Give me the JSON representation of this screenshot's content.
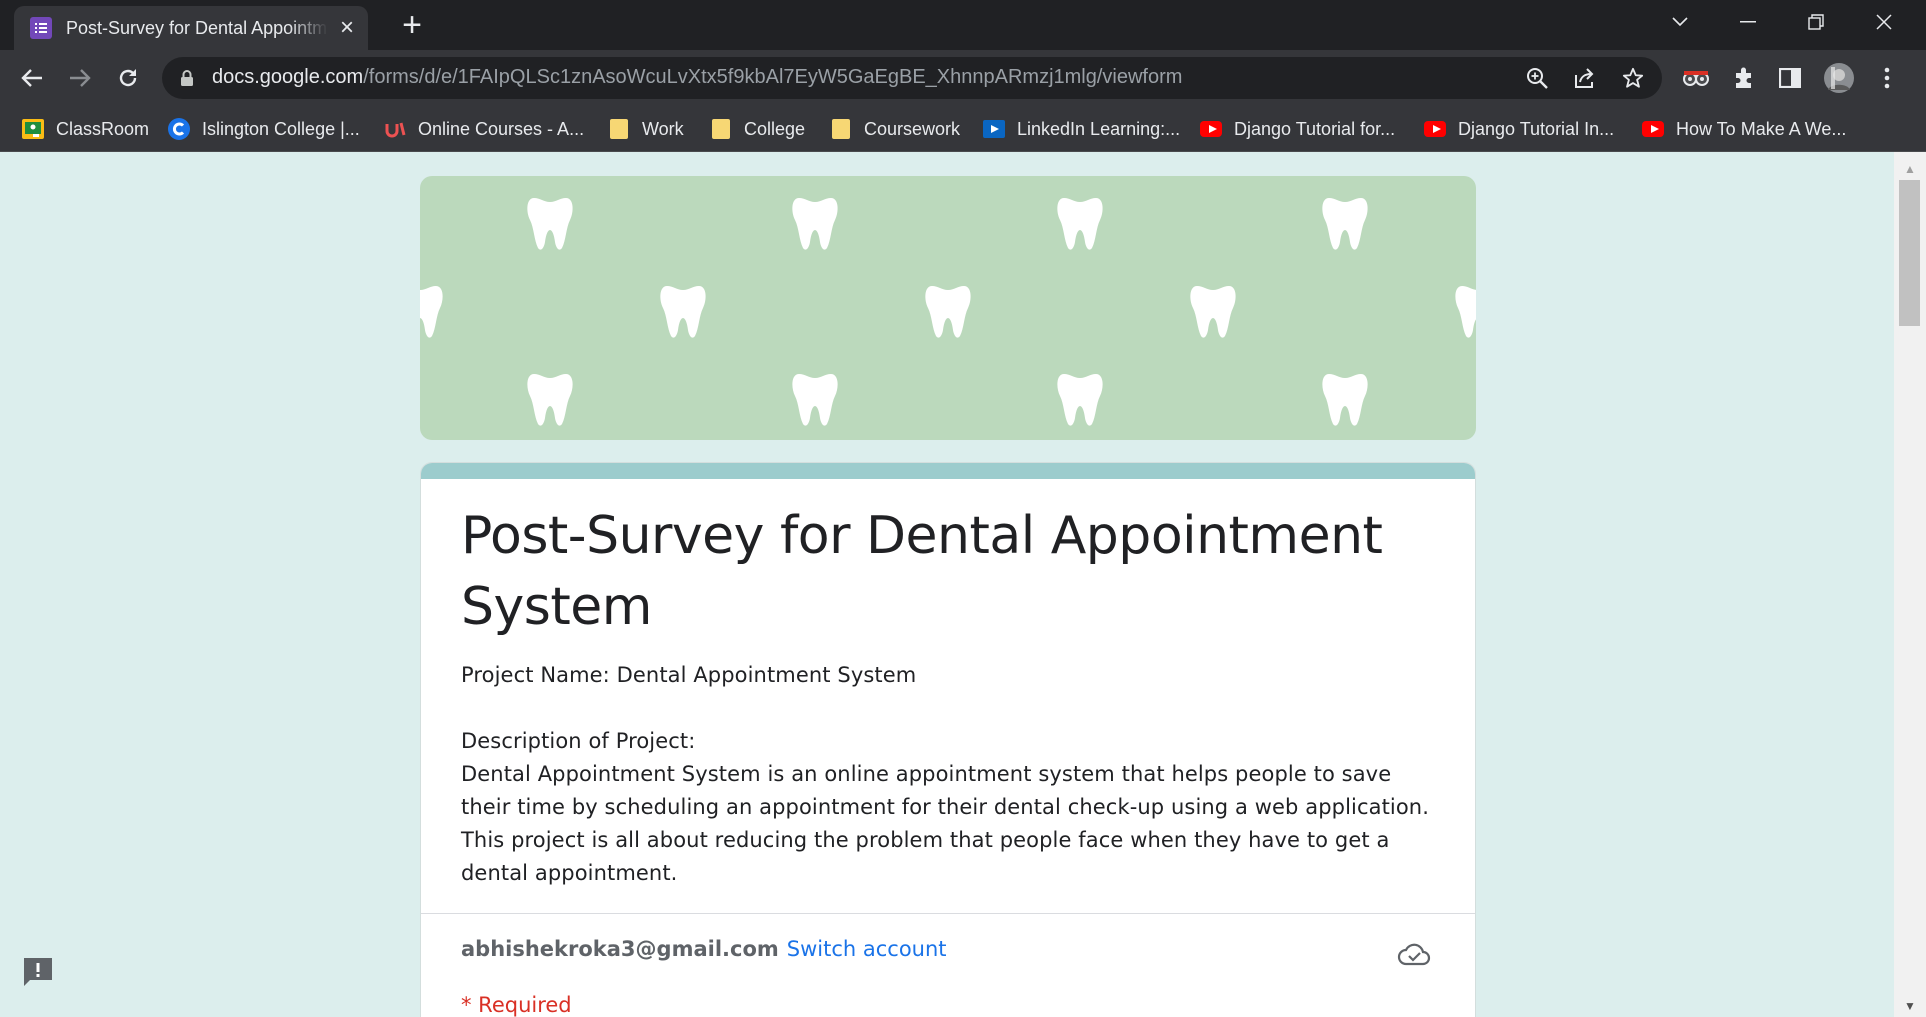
{
  "browser": {
    "tab_title": "Post-Survey for Dental Appointment System",
    "url_host": "docs.google.com",
    "url_path": "/forms/d/e/1FAIpQLSc1znAsoWcuLvXtx5f9kbAl7EyW5GaEgBE_XhnnpARmzj1mlg/viewform",
    "bookmarks": [
      {
        "label": "ClassRoom",
        "icon": "google-classroom-icon"
      },
      {
        "label": "Islington College |...",
        "icon": "islington-college-icon"
      },
      {
        "label": "Online Courses - A...",
        "icon": "udemy-icon"
      },
      {
        "label": "Work",
        "icon": "folder-icon"
      },
      {
        "label": "College",
        "icon": "folder-icon"
      },
      {
        "label": "Coursework",
        "icon": "folder-icon"
      },
      {
        "label": "LinkedIn Learning:...",
        "icon": "linkedin-learning-icon"
      },
      {
        "label": "Django Tutorial for...",
        "icon": "youtube-icon"
      },
      {
        "label": "Django Tutorial In...",
        "icon": "youtube-icon"
      },
      {
        "label": "How To Make A We...",
        "icon": "youtube-icon"
      }
    ]
  },
  "form": {
    "title": "Post-Survey for Dental Appointment System",
    "description": "Project Name: Dental Appointment System\n\nDescription of Project:\nDental Appointment System is an online appointment system that helps people to save their time by scheduling an appointment for their dental check-up using a web application. This project is all about reducing the problem that people face when they have to get a dental appointment.",
    "account_email": "abhishekroka3@gmail.com",
    "switch_account_label": "Switch account",
    "required_note": "* Required"
  },
  "colors": {
    "page_background": "#dceeed",
    "banner_background": "#bbd9bc",
    "card_accent": "#9ccccd",
    "link": "#1a73e8",
    "required": "#d93025"
  }
}
